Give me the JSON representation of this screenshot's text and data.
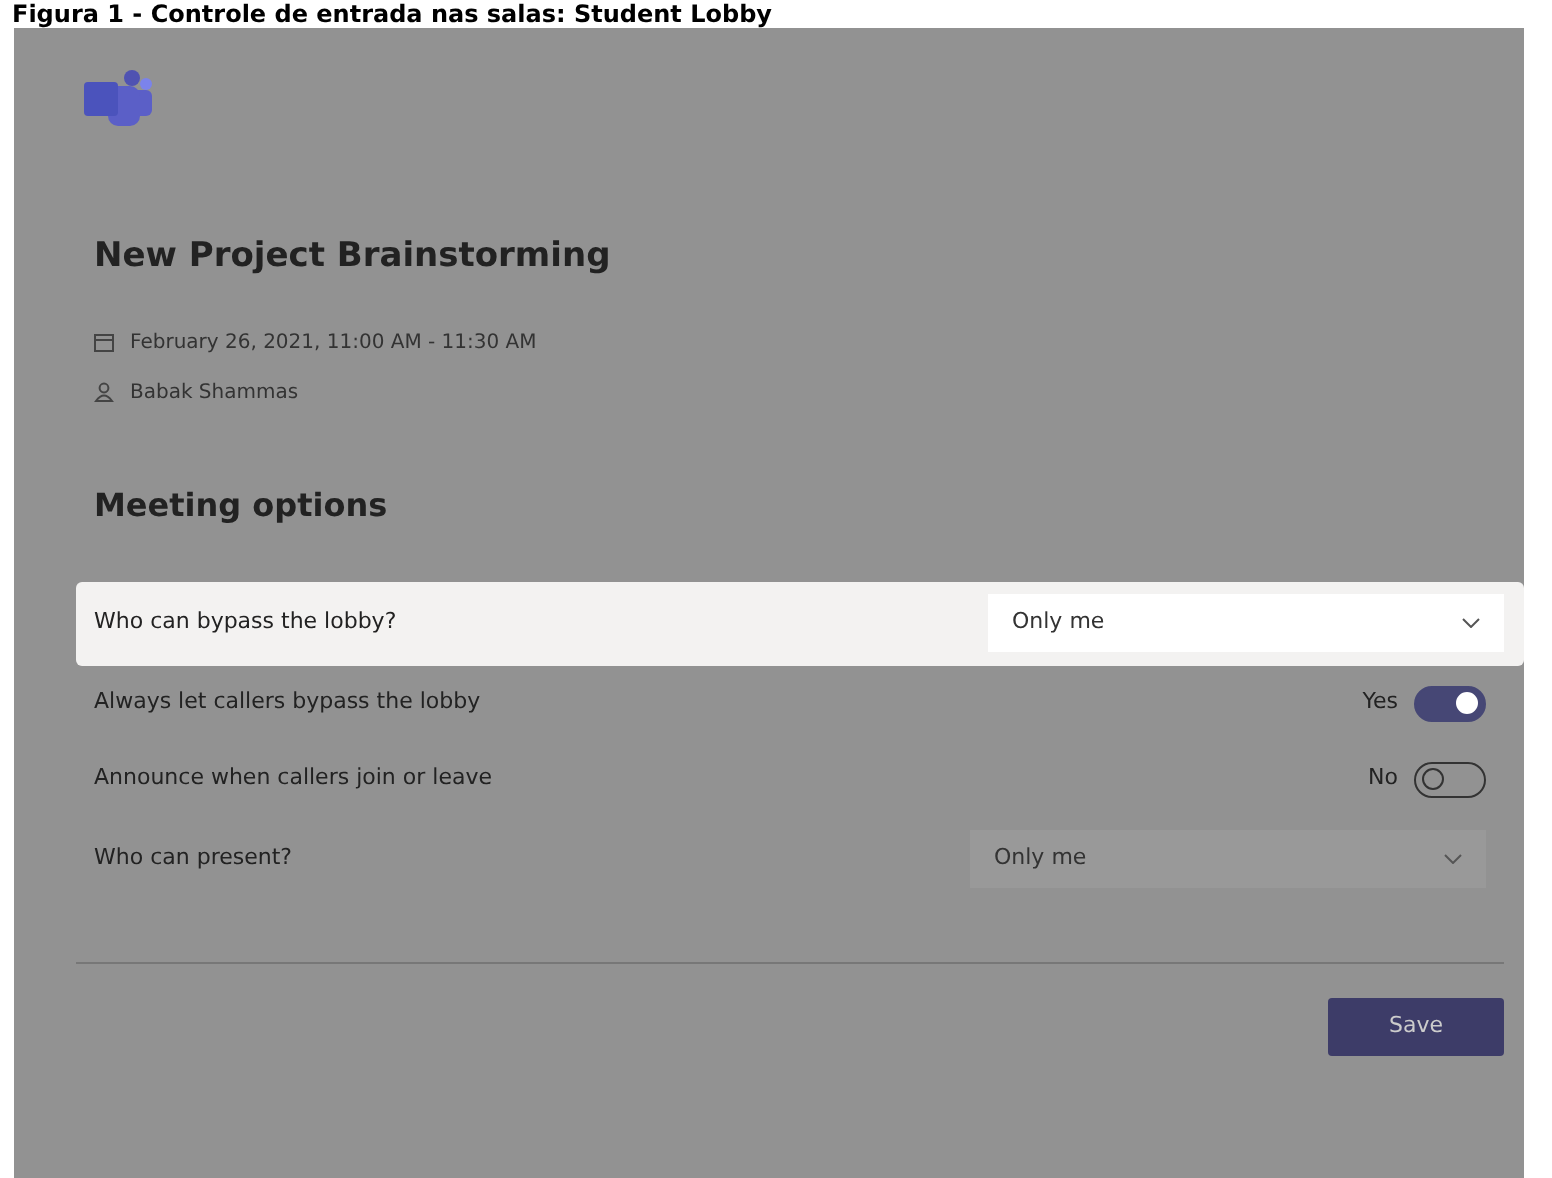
{
  "caption": "Figura 1 - Controle de entrada nas salas: Student Lobby",
  "meeting": {
    "title": "New Project Brainstorming",
    "date": "February 26, 2021, 11:00 AM - 11:30 AM",
    "organizer": "Babak Shammas"
  },
  "options_title": "Meeting options",
  "options": [
    {
      "kind": "dropdown",
      "label": "Who can bypass the lobby?",
      "value": "Only me",
      "highlighted": true
    },
    {
      "kind": "toggle",
      "label": "Always let callers bypass the lobby",
      "state_text": "Yes",
      "on": true
    },
    {
      "kind": "toggle",
      "label": "Announce when callers join or leave",
      "state_text": "No",
      "on": false
    },
    {
      "kind": "dropdown",
      "label": "Who can present?",
      "value": "Only me",
      "highlighted": false
    }
  ],
  "save_button": "Save"
}
